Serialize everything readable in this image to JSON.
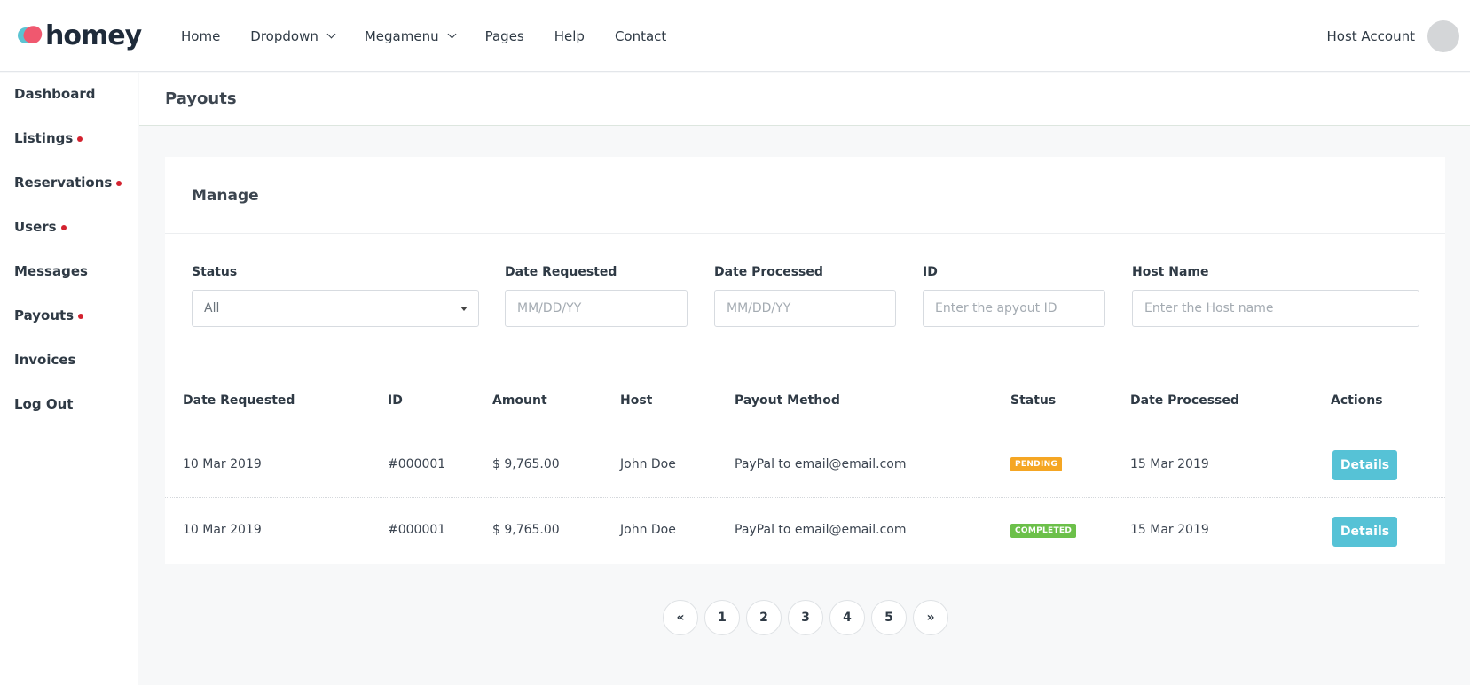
{
  "brand": {
    "name": "homey"
  },
  "nav": {
    "items": [
      {
        "label": "Home",
        "dropdown": false
      },
      {
        "label": "Dropdown",
        "dropdown": true
      },
      {
        "label": "Megamenu",
        "dropdown": true
      },
      {
        "label": "Pages",
        "dropdown": false
      },
      {
        "label": "Help",
        "dropdown": false
      },
      {
        "label": "Contact",
        "dropdown": false
      }
    ],
    "account_label": "Host Account"
  },
  "sidebar": {
    "items": [
      {
        "label": "Dashboard",
        "dot": false
      },
      {
        "label": "Listings",
        "dot": true
      },
      {
        "label": "Reservations",
        "dot": true
      },
      {
        "label": "Users",
        "dot": true
      },
      {
        "label": "Messages",
        "dot": false
      },
      {
        "label": "Payouts",
        "dot": true
      },
      {
        "label": "Invoices",
        "dot": false
      },
      {
        "label": "Log Out",
        "dot": false
      }
    ]
  },
  "page": {
    "title": "Payouts"
  },
  "manage": {
    "title": "Manage",
    "filters": {
      "status": {
        "label": "Status",
        "value": "All"
      },
      "date_requested": {
        "label": "Date Requested",
        "placeholder": "MM/DD/YY"
      },
      "date_processed": {
        "label": "Date Processed",
        "placeholder": "MM/DD/YY"
      },
      "id": {
        "label": "ID",
        "placeholder": "Enter the apyout ID"
      },
      "host_name": {
        "label": "Host Name",
        "placeholder": "Enter the Host name"
      }
    }
  },
  "table": {
    "columns": [
      "Date Requested",
      "ID",
      "Amount",
      "Host",
      "Payout Method",
      "Status",
      "Date Processed",
      "Actions"
    ],
    "rows": [
      {
        "date_requested": "10 Mar 2019",
        "id": "#000001",
        "amount": "$ 9,765.00",
        "host": "John Doe",
        "method": "PayPal to email@email.com",
        "status": "PENDING",
        "date_processed": "15 Mar 2019",
        "action": "Details"
      },
      {
        "date_requested": "10 Mar 2019",
        "id": "#000001",
        "amount": "$ 9,765.00",
        "host": "John Doe",
        "method": "PayPal to email@email.com",
        "status": "COMPLETED",
        "date_processed": "15 Mar 2019",
        "action": "Details"
      }
    ]
  },
  "pagination": {
    "prev": "«",
    "pages": [
      "1",
      "2",
      "3",
      "4",
      "5"
    ],
    "next": "»"
  },
  "colors": {
    "accent": "#56c2d6",
    "pending": "#f5a623",
    "completed": "#6cc04a",
    "dot": "#d3222f"
  }
}
